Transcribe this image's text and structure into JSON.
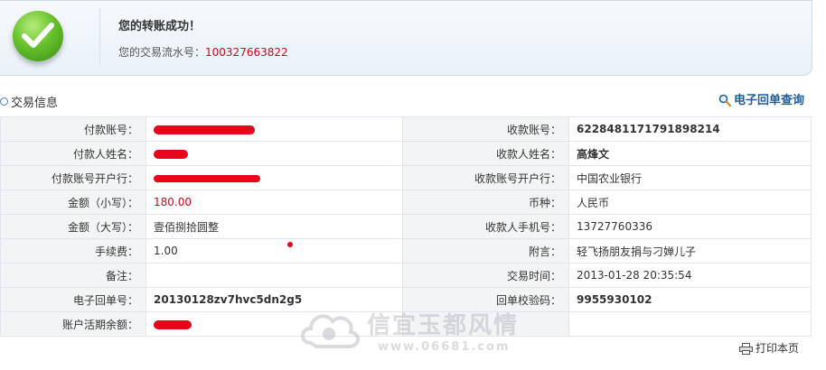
{
  "banner": {
    "title": "您的转账成功！",
    "serial_label": "您的交易流水号：",
    "serial_number": "100327663822"
  },
  "section": {
    "title": "交易信息",
    "receipt_link": "电子回单查询"
  },
  "rows": [
    {
      "l1": "付款账号：",
      "v1": "",
      "l2": "收款账号：",
      "v2": "6228481171791898214"
    },
    {
      "l1": "付款人姓名：",
      "v1": "",
      "l2": "收款人姓名：",
      "v2": "高烽文"
    },
    {
      "l1": "付款账号开户行：",
      "v1": "",
      "l2": "收款账号开户行：",
      "v2": "中国农业银行"
    },
    {
      "l1": "金额（小写）：",
      "v1": "180.00",
      "l2": "币种：",
      "v2": "人民币"
    },
    {
      "l1": "金额（大写）：",
      "v1": "壹佰捌拾圆整",
      "l2": "收款人手机号：",
      "v2": "13727760336"
    },
    {
      "l1": "手续费：",
      "v1": "1.00",
      "l2": "附言：",
      "v2": "轻飞扬朋友捐与刁婵儿子"
    },
    {
      "l1": "备注：",
      "v1": "",
      "l2": "交易时间：",
      "v2": "2013-01-28 20:35:54"
    },
    {
      "l1": "电子回单号：",
      "v1": "20130128zv7hvc5dn2g5",
      "l2": "回单校验码：",
      "v2": "9955930102"
    },
    {
      "l1": "账户活期余额：",
      "v1": "",
      "l2": "",
      "v2": ""
    }
  ],
  "print_label": "打印本页",
  "watermark": {
    "text": "信宜玉都风情",
    "url": "www.06681.com"
  },
  "colors": {
    "accent_red": "#d0021b",
    "link_blue": "#1f5d99"
  }
}
